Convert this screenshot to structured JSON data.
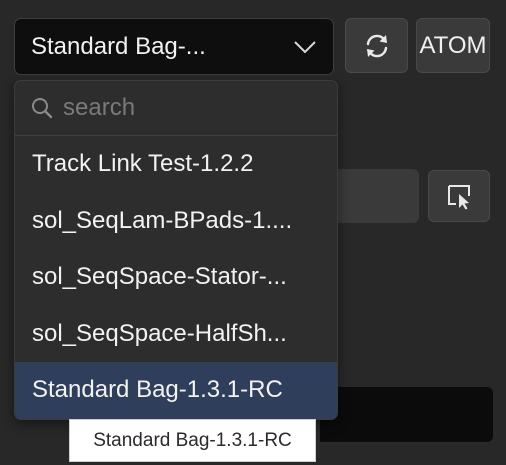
{
  "selector": {
    "value": "Standard Bag-...",
    "icon": "chevron-down-icon"
  },
  "toolbar": {
    "refresh_icon": "refresh-icon",
    "atom_label": "ATOM",
    "pick_icon": "select-element-icon"
  },
  "dropdown": {
    "search_placeholder": "search",
    "search_value": "",
    "options": [
      "Track Link Test-1.2.2",
      "sol_SeqLam-BPads-1....",
      "sol_SeqSpace-Stator-...",
      "sol_SeqSpace-HalfSh...",
      "Standard Bag-1.3.1-RC"
    ],
    "selected_index": 4
  },
  "tooltip": {
    "text": "Standard Bag-1.3.1-RC"
  },
  "colors": {
    "background": "#282828",
    "selected_option": "#2f3e5b",
    "dropdown_bg": "#2d2d2d"
  }
}
